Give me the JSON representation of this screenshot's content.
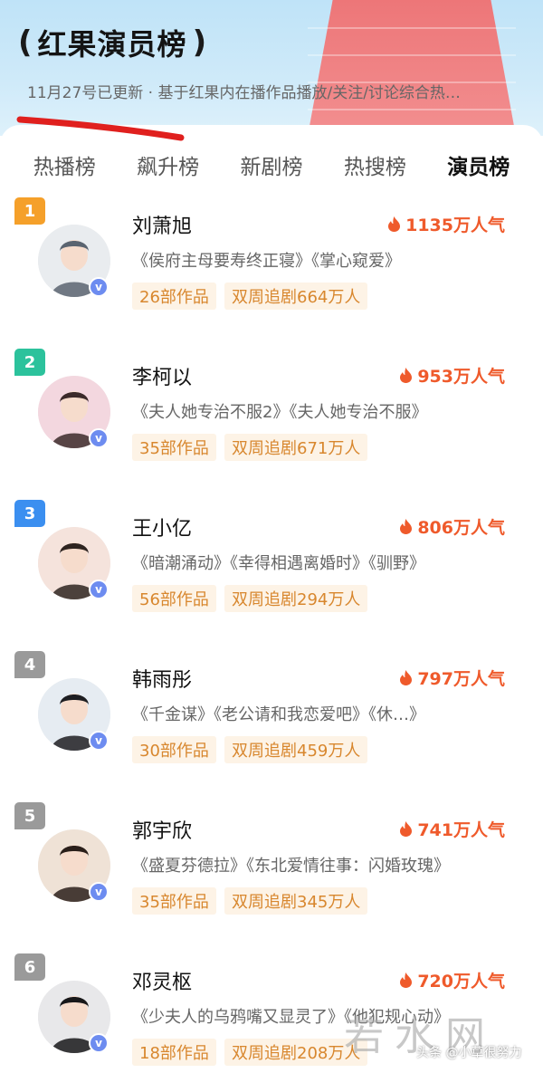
{
  "header": {
    "title": "红果演员榜",
    "subtitle": "11月27号已更新 · 基于红果内在播作品播放/关注/讨论综合热…"
  },
  "tabs": [
    {
      "label": "热播榜",
      "active": false
    },
    {
      "label": "飙升榜",
      "active": false
    },
    {
      "label": "新剧榜",
      "active": false
    },
    {
      "label": "热搜榜",
      "active": false
    },
    {
      "label": "演员榜",
      "active": true
    }
  ],
  "actors": [
    {
      "rank": "1",
      "name": "刘萧旭",
      "popularity": "1135万人气",
      "works": "《侯府主母要寿终正寝》《掌心窥爱》",
      "count": "26部作品",
      "follow": "双周追剧664万人",
      "rank_color": "#f5a02a"
    },
    {
      "rank": "2",
      "name": "李柯以",
      "popularity": "953万人气",
      "works": "《夫人她专治不服2》《夫人她专治不服》",
      "count": "35部作品",
      "follow": "双周追剧671万人",
      "rank_color": "#2cc29c"
    },
    {
      "rank": "3",
      "name": "王小亿",
      "popularity": "806万人气",
      "works": "《暗潮涌动》《幸得相遇离婚时》《驯野》",
      "count": "56部作品",
      "follow": "双周追剧294万人",
      "rank_color": "#3b8ff0"
    },
    {
      "rank": "4",
      "name": "韩雨彤",
      "popularity": "797万人气",
      "works": "《千金谋》《老公请和我恋爱吧》《休…》",
      "count": "30部作品",
      "follow": "双周追剧459万人",
      "rank_color": "#9a9a9a"
    },
    {
      "rank": "5",
      "name": "郭宇欣",
      "popularity": "741万人气",
      "works": "《盛夏芬德拉》《东北爱情往事：闪婚玫瑰》",
      "count": "35部作品",
      "follow": "双周追剧345万人",
      "rank_color": "#9a9a9a"
    },
    {
      "rank": "6",
      "name": "邓灵枢",
      "popularity": "720万人气",
      "works": "《少夫人的乌鸦嘴又显灵了》《他犯规心动》",
      "count": "18部作品",
      "follow": "双周追剧208万人",
      "rank_color": "#9a9a9a"
    }
  ],
  "watermark": {
    "text": "若水网",
    "sub": "头条 @小草很努力"
  },
  "colors": {
    "accent": "#ef5a2b",
    "chip_bg": "#fdf3e6",
    "chip_text": "#d8872e"
  }
}
